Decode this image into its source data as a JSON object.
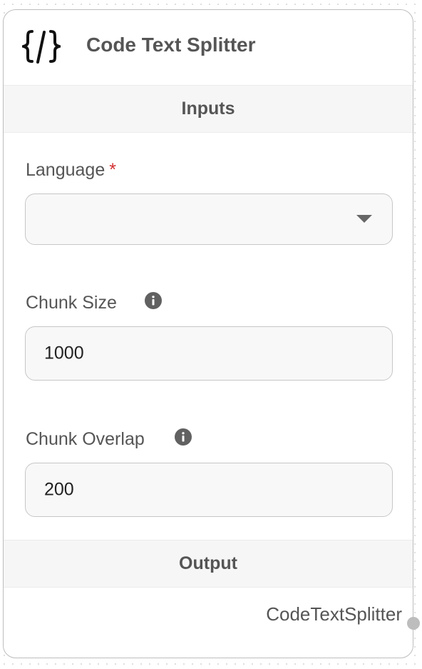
{
  "node": {
    "title": "Code Text Splitter",
    "icon": "code-braces-slash-icon"
  },
  "inputs_section": {
    "label": "Inputs"
  },
  "fields": {
    "language": {
      "label": "Language",
      "required_marker": "*",
      "value": ""
    },
    "chunk_size": {
      "label": "Chunk Size",
      "info_icon": "info-icon",
      "value": "1000"
    },
    "chunk_overlap": {
      "label": "Chunk Overlap",
      "info_icon": "info-icon",
      "value": "200"
    }
  },
  "output_section": {
    "label": "Output",
    "anchor_label": "CodeTextSplitter"
  },
  "colors": {
    "required": "#d32f2f",
    "border": "#bdbdbd",
    "text": "#555555"
  }
}
